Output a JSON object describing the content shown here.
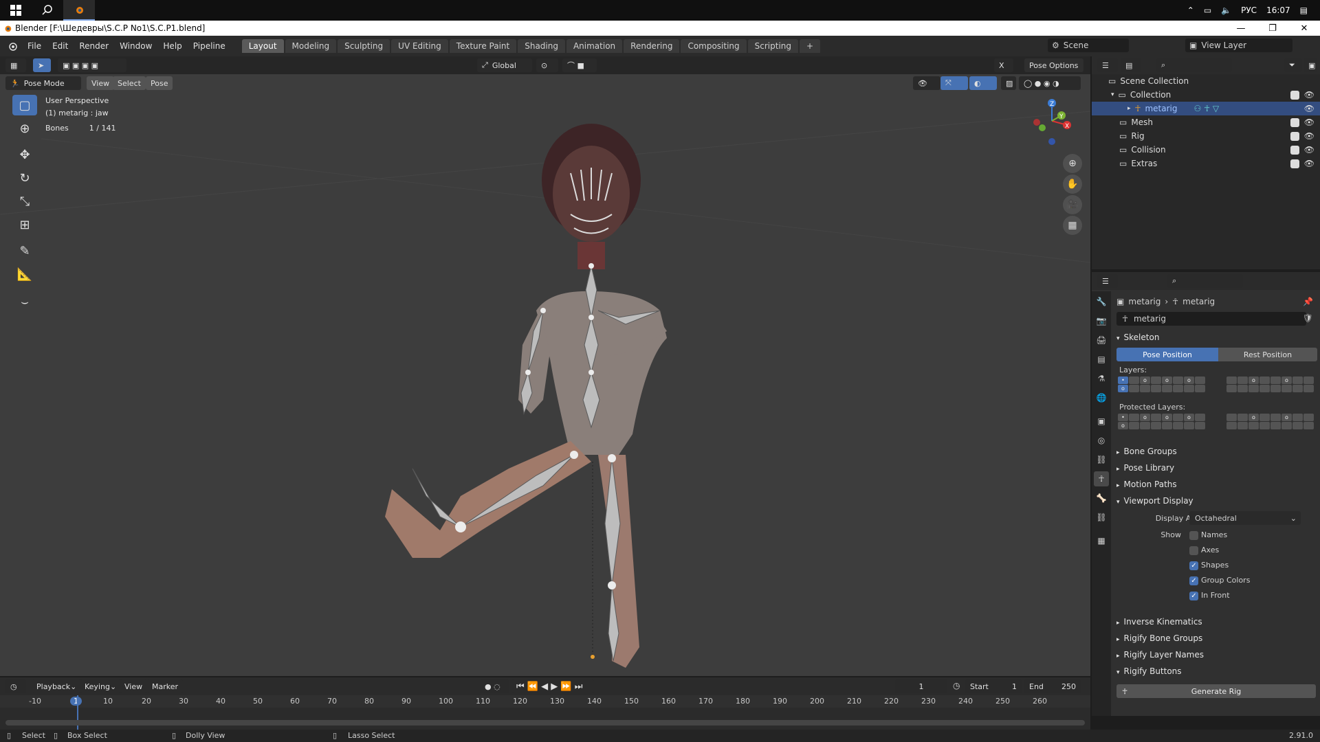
{
  "taskbar": {
    "tray_lang": "РУС",
    "tray_time": "16:07"
  },
  "window": {
    "title": "Blender [F:\\Шедевры\\S.C.P No1\\S.C.P1.blend]"
  },
  "topbar": {
    "menus": [
      "File",
      "Edit",
      "Render",
      "Window",
      "Help",
      "Pipeline"
    ],
    "workspaces": [
      "Layout",
      "Modeling",
      "Sculpting",
      "UV Editing",
      "Texture Paint",
      "Shading",
      "Animation",
      "Rendering",
      "Compositing",
      "Scripting"
    ],
    "active_workspace": "Layout",
    "add_tab": "+",
    "scene_label": "Scene",
    "view_layer_label": "View Layer"
  },
  "viewport": {
    "mode": "Pose Mode",
    "menu_view": "View",
    "menu_select": "Select",
    "menu_pose": "Pose",
    "orientation": "Global",
    "pose_options": "Pose Options",
    "overlay_perspective": "User Perspective",
    "overlay_object": "(1) metarig : jaw",
    "overlay_bones_label": "Bones",
    "overlay_bones_value": "1 / 141",
    "gizmo_x": "X",
    "gizmo_y": "Y",
    "gizmo_z": "Z"
  },
  "outliner": {
    "rows": [
      {
        "label": "Scene Collection"
      },
      {
        "label": "Collection"
      },
      {
        "label": "metarig"
      },
      {
        "label": "Mesh"
      },
      {
        "label": "Rig"
      },
      {
        "label": "Collision"
      },
      {
        "label": "Extras"
      }
    ]
  },
  "properties": {
    "breadcrumb_object": "metarig",
    "breadcrumb_data": "metarig",
    "data_name": "metarig",
    "skeleton_label": "Skeleton",
    "pose_position": "Pose Position",
    "rest_position": "Rest Position",
    "layers_label": "Layers:",
    "protected_layers_label": "Protected Layers:",
    "bone_groups": "Bone Groups",
    "pose_library": "Pose Library",
    "motion_paths": "Motion Paths",
    "viewport_display": "Viewport Display",
    "display_as_label": "Display As",
    "display_as_value": "Octahedral",
    "show_label": "Show",
    "show_names": "Names",
    "show_axes": "Axes",
    "show_shapes": "Shapes",
    "show_group_colors": "Group Colors",
    "show_in_front": "In Front",
    "inverse_kinematics": "Inverse Kinematics",
    "rigify_bone_groups": "Rigify Bone Groups",
    "rigify_layer_names": "Rigify Layer Names",
    "rigify_buttons": "Rigify Buttons",
    "generate_rig": "Generate Rig"
  },
  "timeline": {
    "playback": "Playback",
    "keying": "Keying",
    "view": "View",
    "marker": "Marker",
    "current_frame": "1",
    "start_label": "Start",
    "start_value": "1",
    "end_label": "End",
    "end_value": "250",
    "ticks": [
      "-10",
      "1",
      "10",
      "20",
      "30",
      "40",
      "50",
      "60",
      "70",
      "80",
      "90",
      "100",
      "110",
      "120",
      "130",
      "140",
      "150",
      "160",
      "170",
      "180",
      "190",
      "200",
      "210",
      "220",
      "230",
      "240",
      "250",
      "260"
    ]
  },
  "statusbar": {
    "select": "Select",
    "box_select": "Box Select",
    "dolly_view": "Dolly View",
    "lasso_select": "Lasso Select",
    "version": "2.91.0"
  },
  "colors": {
    "accent": "#4772b3",
    "viewport_bg": "#3d3d3d",
    "panel_bg": "#303030"
  }
}
